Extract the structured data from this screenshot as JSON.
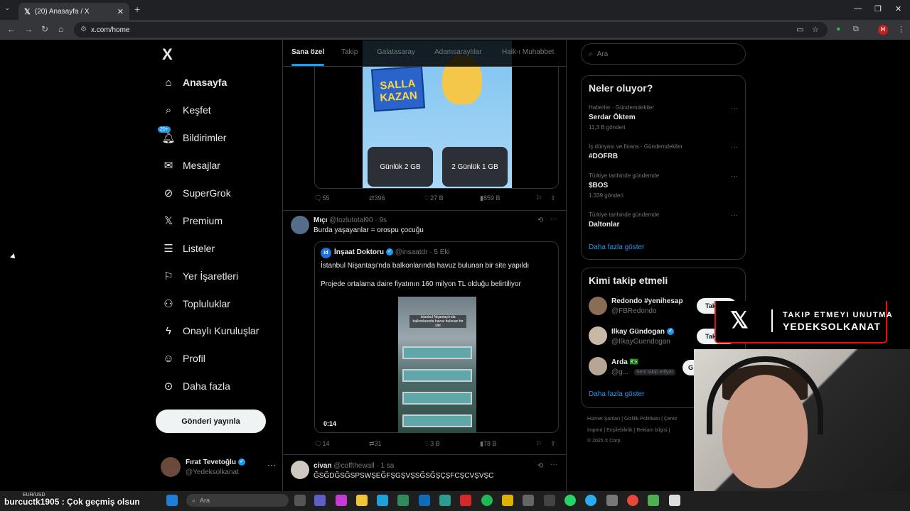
{
  "browser": {
    "tab_title": "(20) Anasayfa / X",
    "url": "x.com/home",
    "profile_initial": "H"
  },
  "sidebar": {
    "logo": "X",
    "items": [
      {
        "label": "Anasayfa",
        "icon": "home-icon"
      },
      {
        "label": "Keşfet",
        "icon": "search-icon"
      },
      {
        "label": "Bildirimler",
        "icon": "bell-icon",
        "badge": "20+"
      },
      {
        "label": "Mesajlar",
        "icon": "mail-icon"
      },
      {
        "label": "SuperGrok",
        "icon": "grok-icon"
      },
      {
        "label": "Premium",
        "icon": "x-icon"
      },
      {
        "label": "Listeler",
        "icon": "list-icon"
      },
      {
        "label": "Yer İşaretleri",
        "icon": "bookmark-icon"
      },
      {
        "label": "Topluluklar",
        "icon": "people-icon"
      },
      {
        "label": "Onaylı Kuruluşlar",
        "icon": "lightning-icon"
      },
      {
        "label": "Profil",
        "icon": "person-icon"
      },
      {
        "label": "Daha fazla",
        "icon": "more-circle-icon"
      }
    ],
    "post_button": "Gönderi yayınla",
    "account": {
      "name": "Fırat Tevetoğlu",
      "handle": "@Yedeksolkanat"
    }
  },
  "timeline": {
    "tabs": [
      "Sana özel",
      "Takip",
      "Galatasaray",
      "Adamsaraylılar",
      "Halk-ı Muhabbet"
    ],
    "promo": {
      "text_top": "SALLA",
      "text_bottom": "KAZAN",
      "button_1": "Günlük 2 GB",
      "button_2": "2 Günlük 1 GB",
      "replies": "55",
      "reposts": "396",
      "likes": "27 B",
      "views": "859 B"
    },
    "tweet1": {
      "name": "Mıçı",
      "handle": "@tozlutotal90 · 9s",
      "text": "Burda yaşayanlar = orospu çocuğu",
      "quote": {
        "avatar": "id",
        "name": "İnşaat Doktoru",
        "handle": "@insaatdr · 5 Eki",
        "line1": "İstanbul Nişantaşı'nda balkonlarında havuz bulunan bir site yapıldı",
        "line2": "Projede ortalama daire fiyatının 160 milyon TL olduğu belirtiliyor",
        "media_caption": "İstanbul Nişantaşı'nda balkonlarında havuz bulunan bir site",
        "duration": "0:14"
      },
      "replies": "14",
      "reposts": "31",
      "likes": "3 B",
      "views": "78 B"
    },
    "tweet2": {
      "name": "civan",
      "handle": "@coffthewall · 1 sa",
      "text": "ĞSĞDĞSĞSPSWŞEĞFŞGŞVŞSĞSĞŞÇŞFCŞCVŞVŞC"
    }
  },
  "right": {
    "search_placeholder": "Ara",
    "trends_title": "Neler oluyor?",
    "trends": [
      {
        "meta": "Haberler · Gündemdekiler",
        "name": "Serdar Öktem",
        "count": "11,3 B gönderi"
      },
      {
        "meta": "İş dünyası ve finans · Gündemdekiler",
        "name": "#DOFRB",
        "count": ""
      },
      {
        "meta": "Türkiye tarihinde gündemde",
        "name": "$BOS",
        "count": "1.339 gönderi"
      },
      {
        "meta": "Türkiye tarihinde gündemde",
        "name": "Daltonlar",
        "count": ""
      }
    ],
    "show_more": "Daha fazla göster",
    "wtf_title": "Kimi takip etmeli",
    "who_to_follow": [
      {
        "name": "Redondo #yenihesap",
        "handle": "@FBRedondo",
        "button": "Takip"
      },
      {
        "name": "Ilkay Gündogan",
        "handle": "@IlkayGuendogan",
        "button": "Takip"
      },
      {
        "name": "Arda 🇧🇷",
        "handle": "@g...",
        "follows_you": "Seni takip ediyor",
        "button": "G"
      }
    ],
    "footer_line1": "Hizmet Şartları  |  Gizlilik Politikası  |  Çerez",
    "footer_line2": "İmprint  |  Erişilebilirlik  |  Reklam bilgisi  |",
    "footer_line3": "© 2025 X Corp."
  },
  "stream": {
    "banner_line1": "TAKIP ETMEYI UNUTMA",
    "banner_line2": "YEDEKSOLKANAT",
    "chat": "burcuctk1905 : Çok geçmiş olsun",
    "ticker": "EUR/USD"
  },
  "taskbar": {
    "search_placeholder": "Ara"
  }
}
